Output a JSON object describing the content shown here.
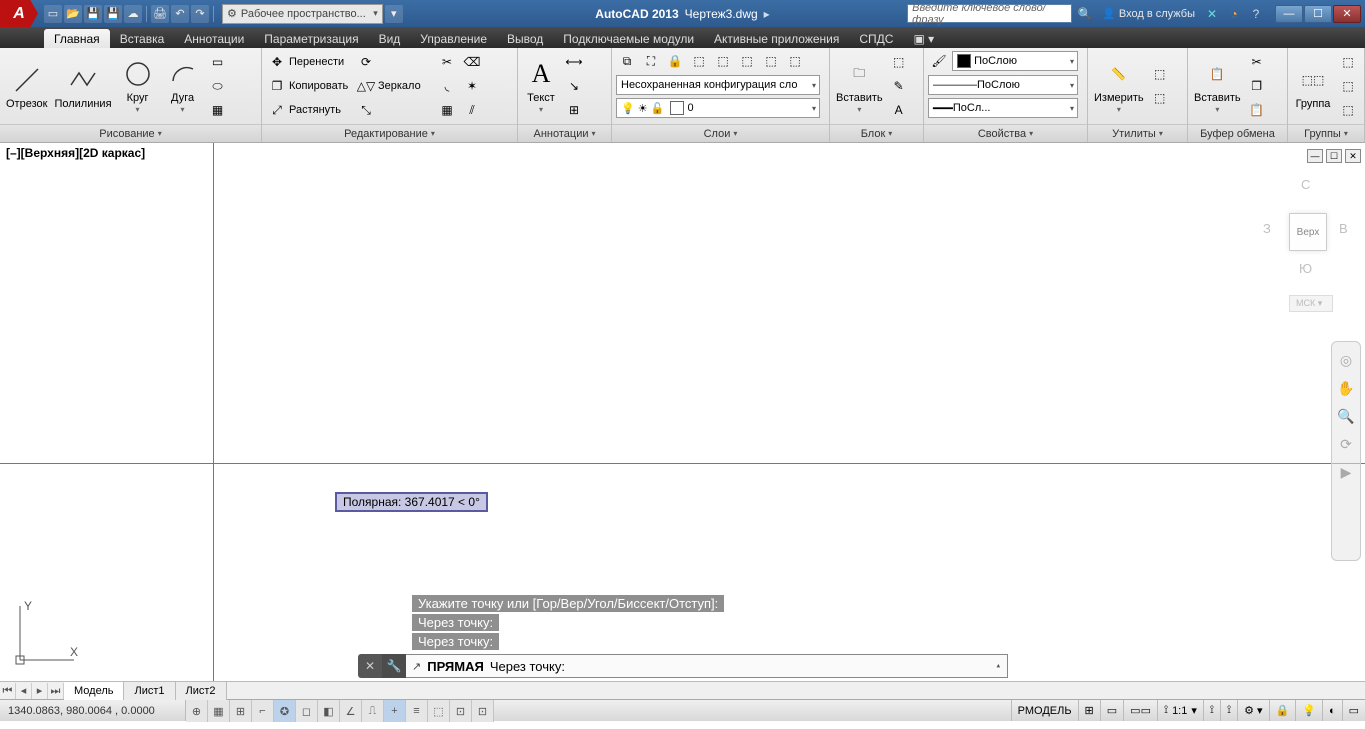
{
  "title": {
    "app": "AutoCAD 2013",
    "file": "Чертеж3.dwg"
  },
  "qat_workspace": "Рабочее пространство...",
  "search": {
    "placeholder": "Введите ключевое слово/фразу"
  },
  "signin": "Вход в службы",
  "tabs": {
    "main": "Главная",
    "insert": "Вставка",
    "annot": "Аннотации",
    "param": "Параметризация",
    "view": "Вид",
    "manage": "Управление",
    "output": "Вывод",
    "plugins": "Подключаемые модули",
    "active": "Активные приложения",
    "spds": "СПДС"
  },
  "ribbon": {
    "draw": {
      "title": "Рисование",
      "line": "Отрезок",
      "pline": "Полилиния",
      "circle": "Круг",
      "arc": "Дуга"
    },
    "modify": {
      "title": "Редактирование",
      "move": "Перенести",
      "copy": "Копировать",
      "mirror": "Зеркало",
      "stretch": "Растянуть"
    },
    "annot": {
      "title": "Аннотации",
      "text": "Текст"
    },
    "layers": {
      "title": "Слои",
      "state": "Несохраненная конфигурация сло",
      "current": "0"
    },
    "block": {
      "title": "Блок",
      "insert": "Вставить"
    },
    "props": {
      "title": "Свойства",
      "color": "ПоСлою",
      "ltype": "ПоСлою",
      "lweight": "ПоСл..."
    },
    "utils": {
      "title": "Утилиты",
      "measure": "Измерить"
    },
    "clip": {
      "title": "Буфер обмена",
      "paste": "Вставить"
    },
    "groups": {
      "title": "Группы",
      "group": "Группа"
    }
  },
  "viewport": {
    "label": "[–][Верхняя][2D каркас]",
    "north": "С",
    "south": "Ю",
    "east": "В",
    "west": "З",
    "top": "Верх",
    "wcs": "МСК"
  },
  "tooltip": "Полярная: 367.4017 < 0°",
  "cmd": {
    "hist1": "Укажите точку или [Гор/Вер/Угол/Биссект/Отступ]:",
    "hist2": "Через точку:",
    "hist3": "Через точку:",
    "active": "ПРЯМАЯ",
    "prompt": "Через точку:"
  },
  "layouts": {
    "model": "Модель",
    "l1": "Лист1",
    "l2": "Лист2"
  },
  "status": {
    "coords": "1340.0863, 980.0064 , 0.0000",
    "space": "РМОДЕЛЬ",
    "scale": "1:1"
  }
}
